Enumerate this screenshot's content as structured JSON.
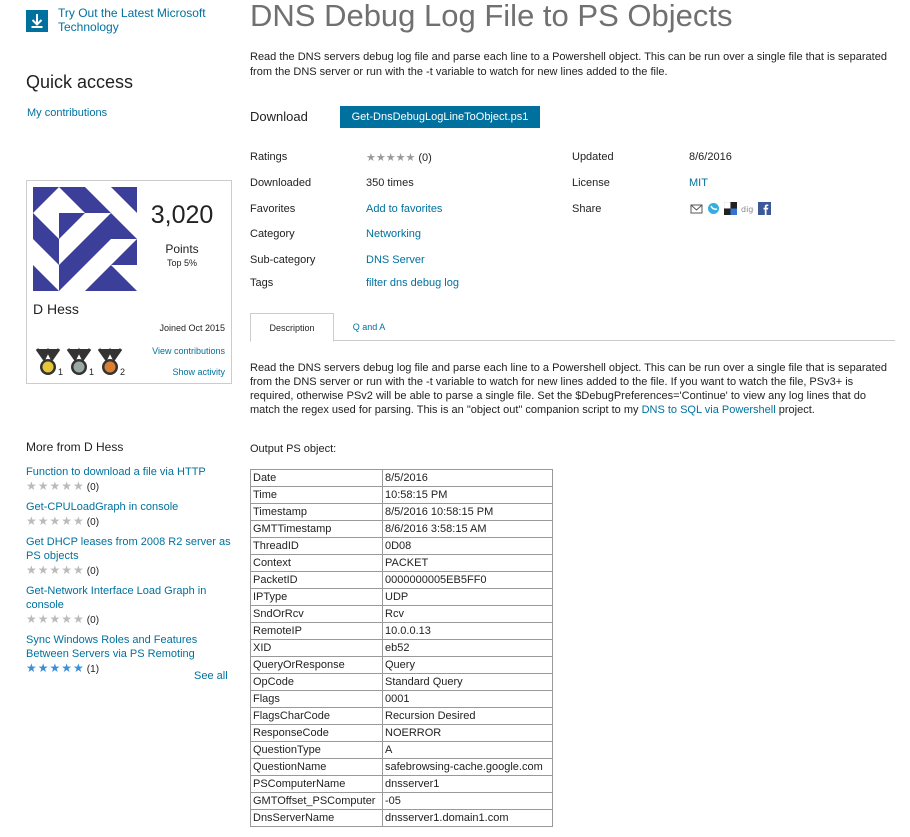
{
  "promo": {
    "text_line1": "Try Out the Latest Microsoft",
    "text_line2": "Technology",
    "icon": "download-icon"
  },
  "quick_access": {
    "title": "Quick access",
    "link": "My contributions"
  },
  "profile": {
    "points": "3,020",
    "points_label": "Points",
    "top_label": "Top 5%",
    "name": "D Hess",
    "joined": "Joined Oct 2015",
    "medals": [
      {
        "name": "gold-medal-icon",
        "count": "1",
        "color": "#e9c53c"
      },
      {
        "name": "silver-medal-icon",
        "count": "1",
        "color": "#9aa9a6"
      },
      {
        "name": "bronze-medal-icon",
        "count": "2",
        "color": "#d97f33"
      }
    ],
    "view_contributions": "View contributions",
    "show_activity": "Show activity"
  },
  "more": {
    "title": "More from D Hess",
    "items": [
      {
        "title_lines": [
          "Function to download a file via HTTP"
        ],
        "stars": "★★★★★",
        "count": "(0)",
        "rated": false
      },
      {
        "title_lines": [
          "Get-CPULoadGraph in console"
        ],
        "stars": "★★★★★",
        "count": "(0)",
        "rated": false
      },
      {
        "title_lines": [
          "Get DHCP leases from 2008 R2 server as",
          "PS objects"
        ],
        "stars": "★★★★★",
        "count": "(0)",
        "rated": false
      },
      {
        "title_lines": [
          "Get-Network Interface Load Graph in",
          "console"
        ],
        "stars": "★★★★★",
        "count": "(0)",
        "rated": false
      },
      {
        "title_lines": [
          "Sync Windows Roles and Features",
          "Between Servers via PS Remoting"
        ],
        "stars": "★★★★★",
        "count": "(1)",
        "rated": true
      }
    ],
    "see_all": "See all"
  },
  "main": {
    "title": "DNS Debug Log File to PS Objects",
    "summary": "Read the DNS servers debug log file and parse each line to a Powershell object.  This can be run over a single file that is separated from the DNS server or run with the -t variable to watch for new lines added to the file.",
    "download_label": "Download",
    "download_button": "Get-DnsDebugLogLineToObject.ps1"
  },
  "meta": {
    "ratings_label": "Ratings",
    "ratings_stars": "★★★★★",
    "ratings_count": "(0)",
    "downloaded_label": "Downloaded",
    "downloaded_value": "350 times",
    "favorites_label": "Favorites",
    "favorites_value": "Add to favorites",
    "category_label": "Category",
    "category_value": "Networking",
    "subcategory_label": "Sub-category",
    "subcategory_value": "DNS Server",
    "tags_label": "Tags",
    "tags_value": "filter dns debug log",
    "updated_label": "Updated",
    "updated_value": "8/6/2016",
    "license_label": "License",
    "license_value": "MIT",
    "share_label": "Share",
    "share_icons": [
      "email-icon",
      "twitter-icon",
      "delicious-icon",
      "digg-icon",
      "facebook-icon"
    ]
  },
  "tabs": {
    "description": "Description",
    "qa": "Q and A"
  },
  "description": {
    "text_before_link": "Read the DNS servers debug log file and parse each line to a Powershell object.  This can be run over a single file that is separated from the DNS server or run with the -t variable to watch for new lines added to the file.  If you want to watch the file, PSv3+ is required, otherwise PSv2 will be able to parse a single file.  Set the $DebugPreferences='Continue' to view any log lines that do match the regex used for parsing.  This is an \"object out\" companion script to my ",
    "link_text": "DNS to SQL via Powershell",
    "text_after_link": " project.",
    "output_label": "Output PS object:"
  },
  "ps_table": [
    [
      "Date",
      "8/5/2016"
    ],
    [
      "Time",
      "10:58:15 PM"
    ],
    [
      "Timestamp",
      "8/5/2016 10:58:15 PM"
    ],
    [
      "GMTTimestamp",
      "8/6/2016 3:58:15 AM"
    ],
    [
      "ThreadID",
      "0D08"
    ],
    [
      "Context",
      "PACKET"
    ],
    [
      "PacketID",
      "0000000005EB5FF0"
    ],
    [
      "IPType",
      "UDP"
    ],
    [
      "SndOrRcv",
      "Rcv"
    ],
    [
      "RemoteIP",
      "10.0.0.13"
    ],
    [
      "XID",
      "eb52"
    ],
    [
      "QueryOrResponse",
      "Query"
    ],
    [
      "OpCode",
      "Standard Query"
    ],
    [
      "Flags",
      "0001"
    ],
    [
      "FlagsCharCode",
      "Recursion Desired"
    ],
    [
      "ResponseCode",
      "NOERROR"
    ],
    [
      "QuestionType",
      "A"
    ],
    [
      "QuestionName",
      "safebrowsing-cache.google.com"
    ],
    [
      "PSComputerName",
      "dnsserver1"
    ],
    [
      "GMTOffset_PSComputer",
      "-05"
    ],
    [
      "DnsServerName",
      "dnsserver1.domain1.com"
    ]
  ],
  "colors": {
    "link": "#00719e",
    "button": "#00719e",
    "title": "#707070",
    "avatar": "#3c3f99"
  }
}
